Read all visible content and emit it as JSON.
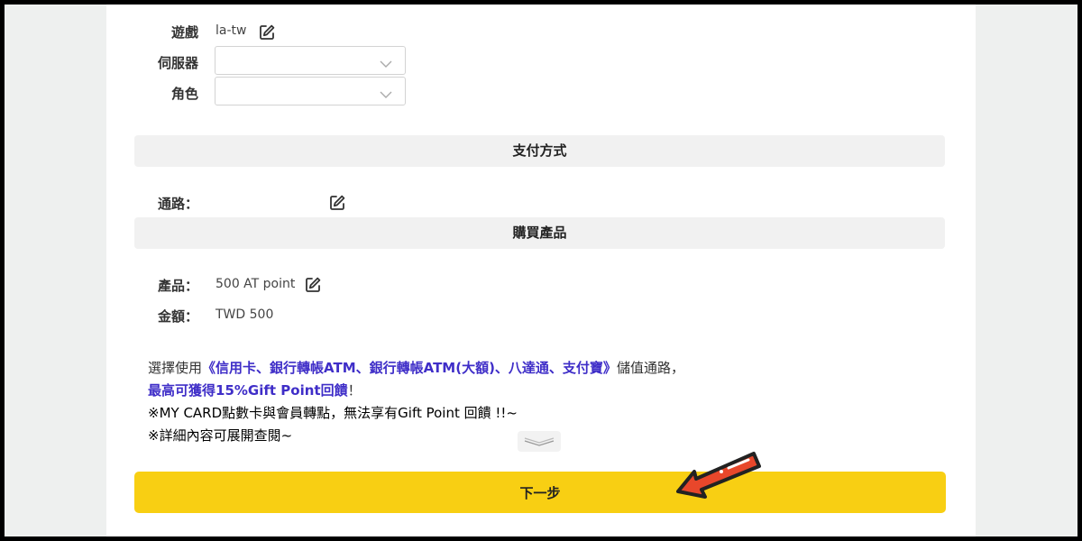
{
  "game": {
    "label": "遊戲",
    "value": "la-tw"
  },
  "server": {
    "label": "伺服器",
    "value": ""
  },
  "character": {
    "label": "角色",
    "value": ""
  },
  "payment_section": {
    "title": "支付方式"
  },
  "channel": {
    "label": "通路：",
    "value": ""
  },
  "purchase_section": {
    "title": "購買產品"
  },
  "product": {
    "label": "產品：",
    "value": "500 AT point"
  },
  "amount": {
    "label": "金額：",
    "value": "TWD 500"
  },
  "promo": {
    "prefix": "選擇使用",
    "channels": "《信用卡、銀行轉帳ATM、銀行轉帳ATM(大額)、八達通、支付寶》",
    "suffix": "儲值通路，",
    "line2_bold": "最高可獲得15%Gift Point回饋",
    "line2_end": "！",
    "line3": "※MY CARD點數卡與會員轉點，無法享有Gift Point 回饋 !!~",
    "line4": "※詳細內容可展開查閱~"
  },
  "next_button": {
    "label": "下一步"
  },
  "icons": {
    "edit": "edit-icon",
    "chevron": "chevron-down-icon",
    "expand": "double-chevron-down-icon",
    "pointer": "red-arrow-pointer"
  },
  "colors": {
    "accent_yellow": "#f8cf13",
    "promo_blue": "#3f2ec8",
    "promo_red": "#e49a95",
    "arrow_red": "#e8472b"
  }
}
